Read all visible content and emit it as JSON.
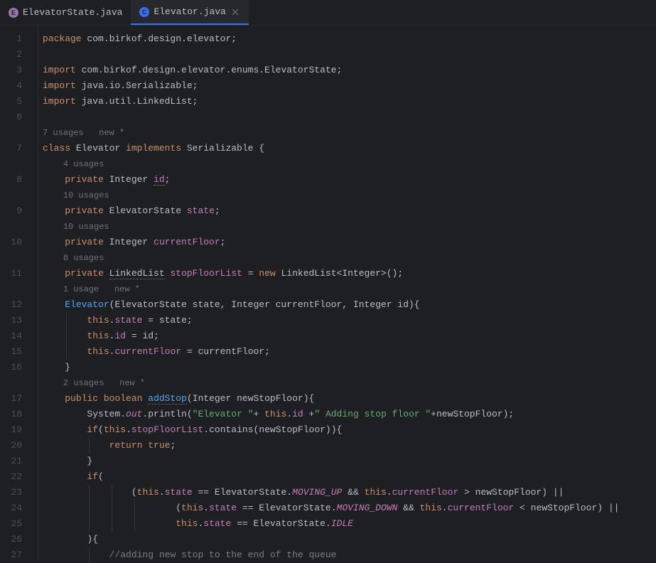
{
  "tabs": [
    {
      "label": "ElevatorState.java",
      "icon": "E",
      "iconColor": "#9876aa",
      "active": false
    },
    {
      "label": "Elevator.java",
      "icon": "C",
      "iconColor": "#3573f0",
      "active": true
    }
  ],
  "gutter": [
    "1",
    "2",
    "3",
    "4",
    "5",
    "6",
    "",
    "7",
    "",
    "8",
    "",
    "9",
    "",
    "10",
    "",
    "11",
    "",
    "12",
    "13",
    "14",
    "15",
    "16",
    "",
    "17",
    "18",
    "19",
    "20",
    "21",
    "22",
    "23",
    "24",
    "25",
    "26",
    "27"
  ],
  "hints": {
    "l7": "7 usages   new *",
    "l8": "4 usages",
    "l9": "10 usages",
    "l10": "10 usages",
    "l11": "8 usages",
    "l12": "1 usage   new *",
    "l17": "2 usages   new *"
  },
  "c": {
    "package": "package",
    "import": "import",
    "class": "class",
    "implements": "implements",
    "private": "private",
    "public": "public",
    "boolean": "boolean",
    "if": "if",
    "return": "return",
    "true": "true",
    "this": "this",
    "new": "new",
    "pkgName": " com.birkof.design.elevator;",
    "imp1": " com.birkof.design.elevator.enums.ElevatorState;",
    "imp2": " java.io.Serializable;",
    "imp3": " java.util.LinkedList;",
    "clsName": " Elevator ",
    "impl": " Serializable {",
    "Integer": " Integer ",
    "ElevatorState": " ElevatorState ",
    "LinkedList": "LinkedList",
    "id": "id",
    "semi": ";",
    "state": "state",
    "currentFloor": "currentFloor",
    "stopFloorList": "stopFloorList",
    "eq": " = ",
    "newLL": " LinkedList<Integer>();",
    "ctorName": "Elevator",
    "ctorParams": "(ElevatorState state, Integer currentFloor, Integer id){",
    "thisDot": ".",
    "assignState": " = state;",
    "assignId": " = id;",
    "assignCF": " = currentFloor;",
    "closeBrace": "}",
    "addStop": "addStop",
    "addStopParams": "(Integer newStopFloor){",
    "SystemOut": "System.",
    "out": "out",
    "println": ".println(",
    "str1": "\"Elevator \"",
    "plus": "+ ",
    "plus2": " +",
    "str2": "\" Adding stop floor \"",
    "plusNew": "+newStopFloor);",
    "ifOpen": "(",
    "contains": ".contains(newStopFloor)){",
    "returnTrue": " ",
    "semiOnly": ";",
    "ifOpen2": "(",
    "MOVING_UP": "MOVING_UP",
    "MOVING_DOWN": "MOVING_DOWN",
    "IDLE": "IDLE",
    "eqeq": " == ElevatorState.",
    "and": " && ",
    "gt": " > newStopFloor) ||",
    "lt": " < newStopFloor) ||",
    "closeParenBrace": "){",
    "cmt1": "//adding new stop to the end of the queue",
    "sp4": "    ",
    "sp8": "        ",
    "sp12": "            ",
    "sp16": "                ",
    "sp20": "                    ",
    "sp24": "                        ",
    "sp28": "                            ",
    "lparen": "("
  }
}
